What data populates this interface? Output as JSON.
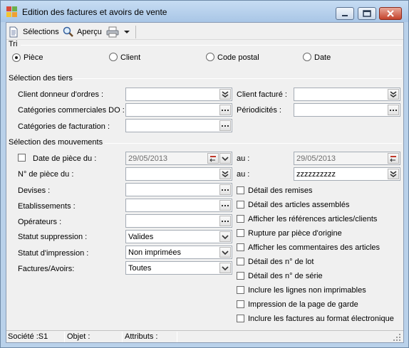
{
  "window": {
    "title": "Edition des factures et avoirs de vente"
  },
  "toolbar": {
    "selections_label": "Sélections",
    "preview_label": "Aperçu"
  },
  "tri": {
    "heading": "Tri",
    "options": [
      "Pièce",
      "Client",
      "Code postal",
      "Date"
    ],
    "selected": "Pièce"
  },
  "tiers": {
    "heading": "Sélection des tiers",
    "client_donneur_label": "Client donneur d'ordres :",
    "client_facture_label": "Client facturé :",
    "categories_commerciales_label": "Catégories commerciales DO :",
    "periodicites_label": "Périodicités :",
    "categories_facturation_label": "Catégories de facturation :"
  },
  "mouvements": {
    "heading": "Sélection des mouvements",
    "date_label": "Date de pièce du :",
    "date_from": "29/05/2013",
    "date_au_label": "au :",
    "date_to": "29/05/2013",
    "piece_label": "N° de pièce du :",
    "piece_au_label": "au :",
    "piece_to": "zzzzzzzzzz",
    "devises_label": "Devises :",
    "etablissements_label": "Etablissements :",
    "operateurs_label": "Opérateurs :",
    "statut_suppression_label": "Statut suppression :",
    "statut_suppression_value": "Valides",
    "statut_impression_label": "Statut d'impression :",
    "statut_impression_value": "Non imprimées",
    "factures_avoirs_label": "Factures/Avoirs:",
    "factures_avoirs_value": "Toutes"
  },
  "options": [
    "Détail des remises",
    "Détail des articles assemblés",
    "Afficher les références articles/clients",
    "Rupture par pièce d'origine",
    "Afficher les commentaires des articles",
    "Détail des n° de lot",
    "Détail des n° de série",
    "Inclure les lignes non imprimables",
    "Impression de la page de garde",
    "Inclure les factures au format électronique"
  ],
  "status": {
    "societe": "Société :S1",
    "objet": "Objet :",
    "attributs": "Attributs :"
  }
}
